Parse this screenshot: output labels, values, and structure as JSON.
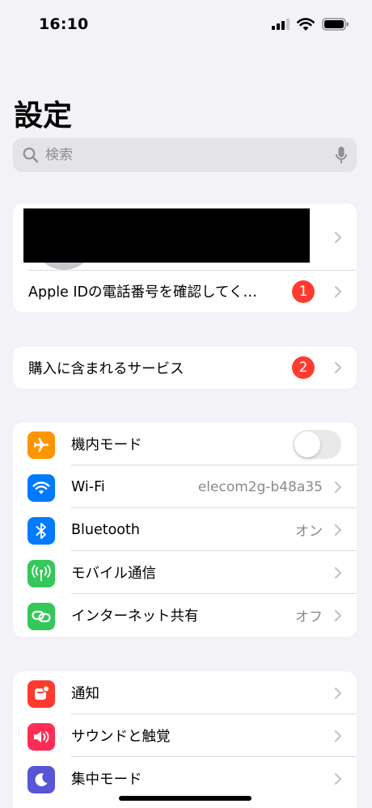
{
  "status_bar": {
    "time": "16:10"
  },
  "header": {
    "title": "設定"
  },
  "search": {
    "placeholder": "検索"
  },
  "account_group": {
    "apple_id_notice": {
      "label": "Apple IDの電話番号を確認してく…",
      "badge": "1"
    }
  },
  "services_group": {
    "purchase_services": {
      "label": "購入に含まれるサービス",
      "badge": "2"
    }
  },
  "connectivity_group": {
    "items": [
      {
        "label": "機内モード",
        "value": "",
        "icon": "airplane-icon",
        "color": "#ff9500",
        "toggle": false
      },
      {
        "label": "Wi-Fi",
        "value": "elecom2g-b48a35",
        "icon": "wifi-icon",
        "color": "#007aff"
      },
      {
        "label": "Bluetooth",
        "value": "オン",
        "icon": "bluetooth-icon",
        "color": "#007aff"
      },
      {
        "label": "モバイル通信",
        "value": "",
        "icon": "antenna-icon",
        "color": "#34c759"
      },
      {
        "label": "インターネット共有",
        "value": "オフ",
        "icon": "link-icon",
        "color": "#34c759"
      }
    ]
  },
  "notification_group": {
    "items": [
      {
        "label": "通知",
        "icon": "bell-icon",
        "color": "#ff3b30"
      },
      {
        "label": "サウンドと触覚",
        "icon": "speaker-icon",
        "color": "#ff2d55"
      },
      {
        "label": "集中モード",
        "icon": "moon-icon",
        "color": "#5856d6"
      }
    ]
  }
}
